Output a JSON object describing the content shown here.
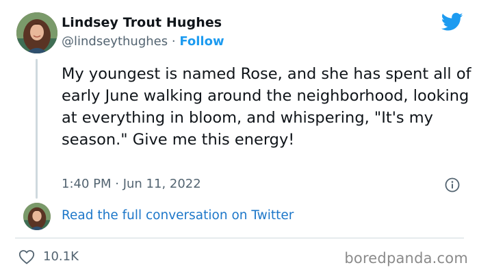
{
  "tweet": {
    "author_name": "Lindsey Trout Hughes",
    "handle": "@lindseythughes",
    "separator": "·",
    "follow_label": "Follow",
    "text": "My youngest is named Rose, and she has spent all of early June walking around the neighborhood, looking at everything in bloom, and whispering, \"It's my season.\" Give me this energy!",
    "timestamp": "1:40 PM · Jun 11, 2022",
    "read_more_label": "Read the full conversation on Twitter",
    "like_count": "10.1K"
  },
  "icons": {
    "brand": "twitter-bird-icon",
    "info": "info-icon",
    "like": "heart-icon"
  },
  "colors": {
    "accent": "#1d9bf0",
    "link": "#1d77c9",
    "secondary_text": "#536471",
    "divider": "#cfd9de"
  },
  "watermark": "boredpanda.com"
}
